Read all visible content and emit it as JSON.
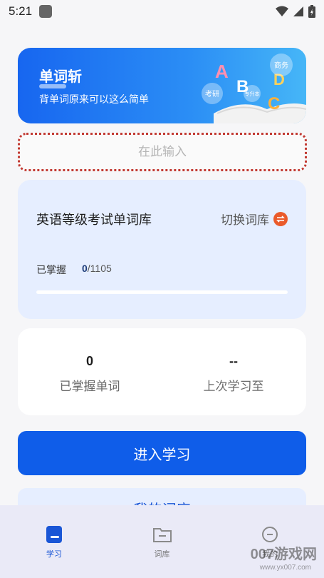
{
  "status_bar": {
    "time": "5:21"
  },
  "banner": {
    "title": "单词斩",
    "subtitle": "背单词原来可以这么简单",
    "tags": [
      "商务",
      "考研",
      "专升本"
    ]
  },
  "search": {
    "placeholder": "在此输入",
    "value": ""
  },
  "library": {
    "name": "英语等级考试单词库",
    "switch_label": "切换词库",
    "mastered_label": "已掌握",
    "mastered": "0",
    "total": "/1105",
    "progress": 0
  },
  "stats": [
    {
      "value": "0",
      "label": "已掌握单词"
    },
    {
      "value": "--",
      "label": "上次学习至"
    }
  ],
  "start_button": "进入学习",
  "my_library_button": "我的词库",
  "tabs": [
    {
      "label": "学习",
      "icon": "study-icon"
    },
    {
      "label": "词库",
      "icon": "folder-icon"
    },
    {
      "label": "我的",
      "icon": "profile-icon"
    }
  ],
  "watermark": {
    "text": "007游戏网",
    "url": "www.yx007.com"
  },
  "colors": {
    "primary": "#0f5de9",
    "card_bg": "#e6eeff",
    "accent_orange": "#ea5a2b",
    "search_border": "#c23a33"
  }
}
